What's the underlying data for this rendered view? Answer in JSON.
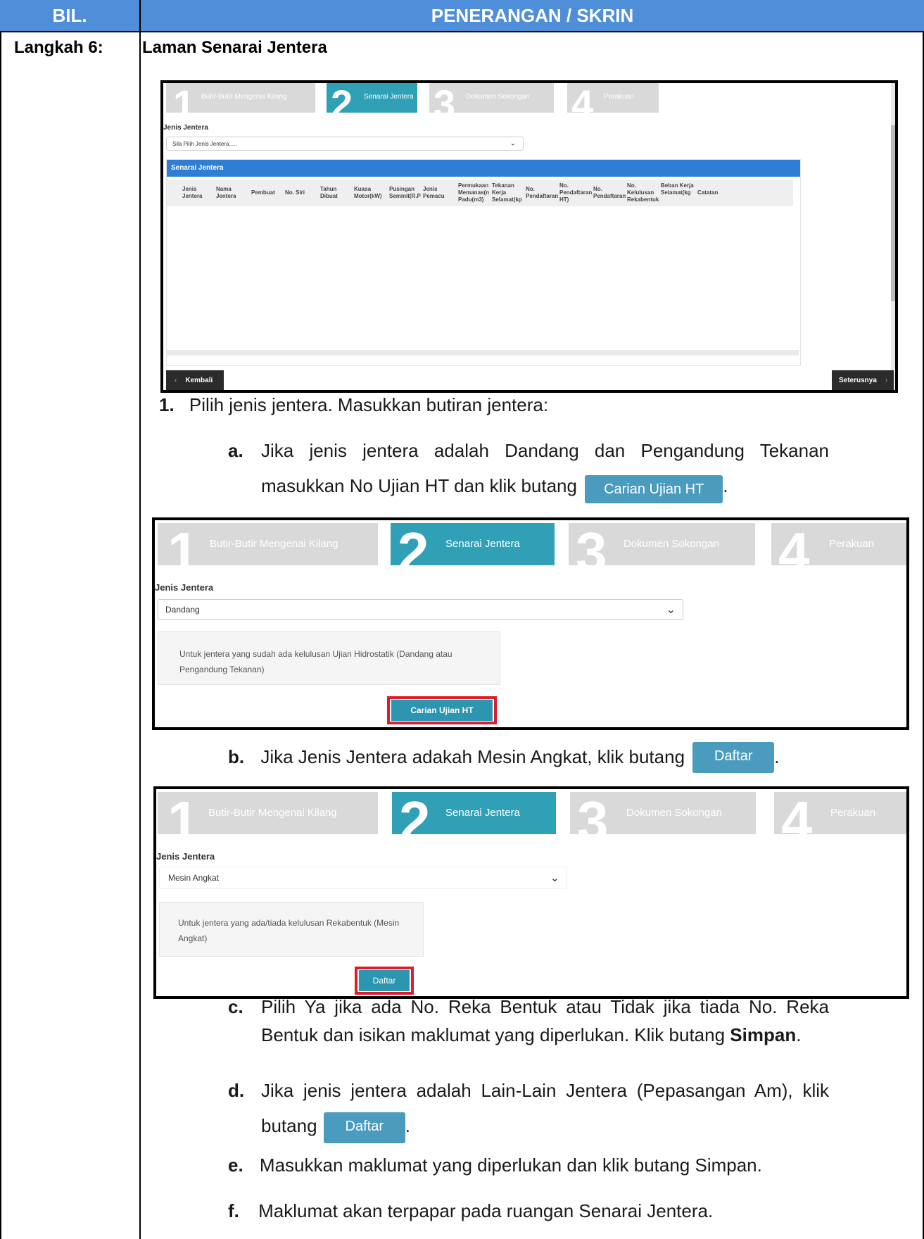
{
  "header": {
    "col1": "BIL.",
    "col2": "PENERANGAN / SKRIN"
  },
  "step": {
    "label": "Langkah 6:",
    "title": "Laman Senarai Jentera"
  },
  "stepper": {
    "steps": [
      {
        "num": "1",
        "label": "Butir-Butir Mengenai Kilang"
      },
      {
        "num": "2",
        "label": "Senarai Jentera"
      },
      {
        "num": "3",
        "label": "Dokumen Sokongan"
      },
      {
        "num": "4",
        "label": "Perakuan"
      }
    ]
  },
  "shot1": {
    "field_label": "Jenis Jentera",
    "select_value": "Sila Pilih Jenis Jentera.....",
    "table_title": "Senarai Jentera",
    "columns": [
      "Jenis Jentera",
      "Nama Jentera",
      "Pembuat",
      "No. Siri",
      "Tahun Dibuat",
      "Kuasa Motor(kW)",
      "Pusingan Seminit(R.P",
      "Jenis Pemacu",
      "Permukaan Memanas(n Padu(m3)",
      "Tekanan Kerja Selamat(kp",
      "No. Pendaftaran",
      "No. Pendaftaran HT)",
      "No. Pendaftaran",
      "No. Kelulusan Rekabentuk",
      "Beban Kerja Selamat(kg",
      "Catatan"
    ],
    "back": "Kembali",
    "next": "Seterusnya"
  },
  "p1": {
    "marker": "1.",
    "text": "Pilih jenis jentera. Masukkan butiran jentera:"
  },
  "pa": {
    "marker": "a.",
    "line1": "Jika jenis jentera adalah Dandang dan Pengandung Tekanan",
    "line2": "masukkan No Ujian HT dan klik butang",
    "button": "Carian Ujian HT",
    "end": "."
  },
  "shot2": {
    "field_label": "Jenis Jentera",
    "select_value": "Dandang",
    "info": "Untuk jentera yang sudah ada kelulusan Ujian Hidrostatik (Dandang atau Pengandung Tekanan)",
    "button": "Carian Ujian HT"
  },
  "pb": {
    "marker": "b.",
    "text": "Jika Jenis Jentera adakah Mesin Angkat, klik butang",
    "button": "Daftar",
    "end": "."
  },
  "shot3": {
    "field_label": "Jenis Jentera",
    "select_value": "Mesin Angkat",
    "info": "Untuk jentera yang ada/tiada kelulusan Rekabentuk (Mesin Angkat)",
    "button": "Daftar"
  },
  "pc": {
    "marker": "c.",
    "line1": "Pilih Ya jika ada No. Reka Bentuk atau Tidak jika tiada No. Reka",
    "line2a": "Bentuk dan isikan maklumat yang diperlukan. Klik butang",
    "line2b": "Simpan",
    "line2c": "."
  },
  "pd": {
    "marker": "d.",
    "line1": "Jika jenis jentera adalah Lain-Lain Jentera (Pepasangan Am), klik",
    "line2": "butang",
    "button": "Daftar",
    "end": "."
  },
  "pe": {
    "marker": "e.",
    "text": "Masukkan maklumat yang diperlukan dan klik butang Simpan."
  },
  "pf": {
    "marker": "f.",
    "text": "Maklumat akan terpapar pada ruangan Senarai Jentera."
  }
}
